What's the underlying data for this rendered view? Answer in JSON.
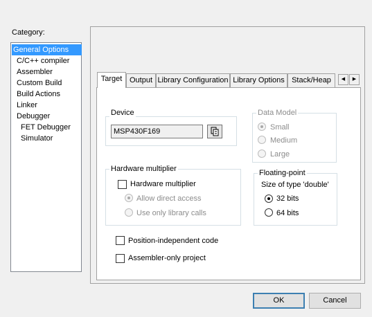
{
  "category": {
    "label": "Category:",
    "items": [
      "General Options",
      "C/C++ compiler",
      "Assembler",
      "Custom Build",
      "Build Actions",
      "Linker",
      "Debugger",
      "FET Debugger",
      "Simulator"
    ],
    "selected": "General Options"
  },
  "tabs": [
    "Target",
    "Output",
    "Library Configuration",
    "Library Options",
    "Stack/Heap"
  ],
  "active_tab": "Target",
  "device": {
    "group_label": "Device",
    "value": "MSP430F169"
  },
  "data_model": {
    "group_label": "Data Model",
    "options": [
      "Small",
      "Medium",
      "Large"
    ],
    "selected": "Small",
    "enabled": false
  },
  "hardware_multiplier": {
    "group_label": "Hardware multiplier",
    "checkbox_label": "Hardware multiplier",
    "checked": false,
    "options": [
      "Allow direct access",
      "Use only library calls"
    ],
    "selected": "Allow direct access",
    "enabled": false
  },
  "floating_point": {
    "group_label": "Floating-point",
    "size_label": "Size of type 'double'",
    "options": [
      "32 bits",
      "64 bits"
    ],
    "selected": "32 bits"
  },
  "checkboxes": {
    "position_independent": "Position-independent code",
    "assembler_only": "Assembler-only project"
  },
  "buttons": {
    "ok": "OK",
    "cancel": "Cancel"
  },
  "icons": {
    "scroll_left": "scroll-left-icon",
    "scroll_right": "scroll-right-icon",
    "device_select": "device-select-icon"
  },
  "colors": {
    "selection": "#3399ff",
    "window": "#f0f0f0"
  }
}
